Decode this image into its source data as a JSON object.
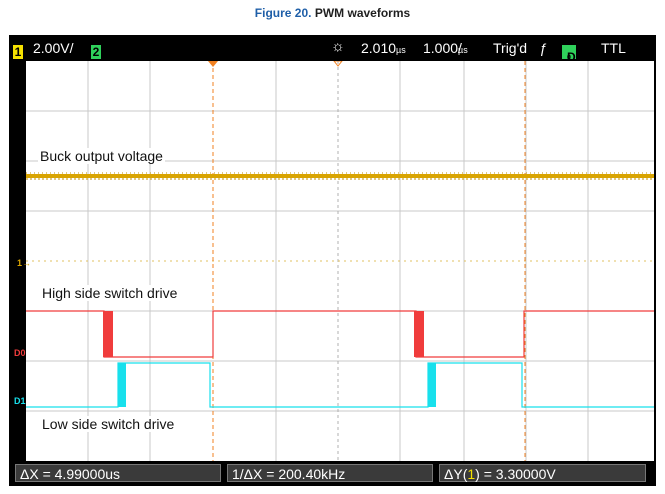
{
  "caption": {
    "figure": "Figure 20.",
    "title": "PWM waveforms"
  },
  "topbar": {
    "ch1_badge": "1",
    "ch1_scale": "2.00V/",
    "ch2_badge": "2",
    "delay": "2.010&#181;s",
    "timebase": "1.000&#181;s/",
    "trigger_status": "Trig'd",
    "trigger_icon": "rising-edge-icon",
    "digital_badge": "D",
    "logic_level": "TTL"
  },
  "labels": {
    "buck": "Buck output voltage",
    "high": "High side switch drive",
    "low": "Low side switch drive"
  },
  "channel_markers": {
    "ch1": "1",
    "d0": "D0",
    "d1": "D1"
  },
  "measurements": {
    "dx": "ΔX = 4.99000us",
    "inv_dx": "1/ΔX = 200.40kHz",
    "dy_prefix": "ΔY(",
    "dy_channel": "1",
    "dy_suffix": ") = 3.30000V"
  },
  "colors": {
    "ch1": "#d9a400",
    "d0": "#f03c3c",
    "d1": "#18e0ec",
    "grid": "#c8c8c8",
    "cursor": "#f08020"
  }
}
